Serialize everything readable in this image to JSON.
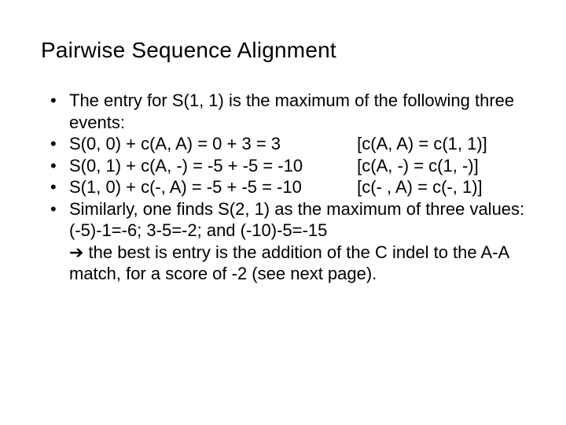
{
  "title": "Pairwise Sequence Alignment",
  "bullets": {
    "intro": "The entry for S(1, 1) is the maximum of the following three events:",
    "eq1": {
      "lhs": "S(0, 0) + c(A, A) = 0 + 3 = 3",
      "rhs": "[c(A, A) = c(1, 1)]"
    },
    "eq2": {
      "lhs": "S(0, 1) + c(A, -) = -5 + -5 = -10",
      "rhs": "[c(A, -) = c(1, -)]"
    },
    "eq3": {
      "lhs": "S(1, 0) + c(-, A) = -5 + -5 = -10",
      "rhs": "[c(- , A) = c(-, 1)]"
    },
    "similarly_a": "Similarly, one finds S(2, 1) as the maximum of three values: (-5)-1=-6; 3-5=-2; and (-10)-5=-15",
    "arrow": "è",
    "similarly_b": " the best is entry is the addition of the C indel to the A-A match, for a score of -2 (see next page)."
  }
}
